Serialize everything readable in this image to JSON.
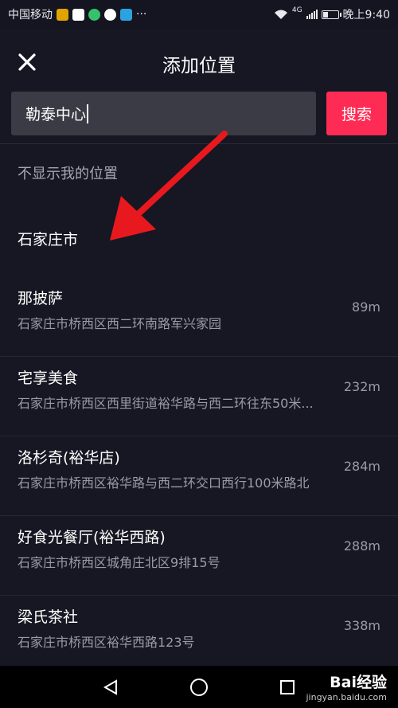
{
  "status_bar": {
    "carrier": "中国移动",
    "network": "4G",
    "time": "晚上9:40",
    "more": "···"
  },
  "header": {
    "title": "添加位置",
    "close_icon": "close-icon"
  },
  "search": {
    "value": "勒泰中心",
    "button_label": "搜索"
  },
  "hide_location_label": "不显示我的位置",
  "city_item": "石家庄市",
  "results": [
    {
      "name": "那披萨",
      "address": "石家庄市桥西区西二环南路军兴家园",
      "distance": "89m"
    },
    {
      "name": "宅享美食",
      "address": "石家庄市桥西区西里街道裕华路与西二环往东50米...",
      "distance": "232m"
    },
    {
      "name": "洛杉奇(裕华店)",
      "address": "石家庄市桥西区裕华路与西二环交口西行100米路北",
      "distance": "284m"
    },
    {
      "name": "好食光餐厅(裕华西路)",
      "address": "石家庄市桥西区城角庄北区9排15号",
      "distance": "288m"
    },
    {
      "name": "梁氏茶社",
      "address": "石家庄市桥西区裕华西路123号",
      "distance": "338m"
    }
  ],
  "watermark": {
    "brand": "Bai经验",
    "url": "jingyan.baidu.com"
  },
  "colors": {
    "background": "#161722",
    "accent": "#fe2c55",
    "input_bg": "#3b3b45",
    "annotation_arrow": "#e8191e"
  }
}
